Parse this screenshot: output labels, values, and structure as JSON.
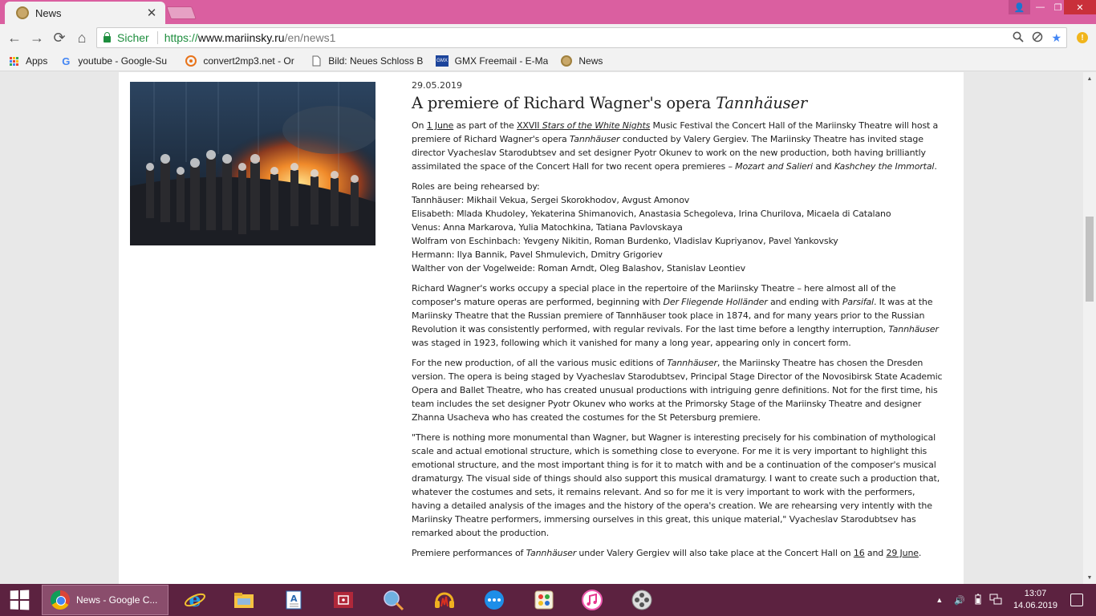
{
  "browser": {
    "tab": {
      "title": "News",
      "close": "✕"
    },
    "window_controls": {
      "user": "👤",
      "minimize": "—",
      "maximize": "❐",
      "close": "✕"
    },
    "toolbar": {
      "back": "←",
      "forward": "→",
      "reload": "⟳",
      "home": "⌂",
      "secure_label": "Sicher",
      "url_scheme": "https://",
      "url_host": "www.mariinsky.ru",
      "url_path": "/en/news1",
      "menu_glyph": "!"
    },
    "bookmarks": [
      {
        "label": "Apps",
        "icon": "apps-grid-icon"
      },
      {
        "label": "youtube - Google-Su",
        "icon": "google-icon"
      },
      {
        "label": "convert2mp3.net - Or",
        "icon": "convert2mp3-icon"
      },
      {
        "label": "Bild: Neues Schloss B",
        "icon": "page-icon"
      },
      {
        "label": "GMX Freemail - E-Ma",
        "icon": "gmx-icon"
      },
      {
        "label": "News",
        "icon": "mariinsky-icon"
      }
    ]
  },
  "article": {
    "date": "29.05.2019",
    "headline_prefix": "A premiere of Richard Wagner's opera ",
    "headline_em": "Tannhäuser",
    "p1": {
      "a": "On ",
      "date_link": "1 June",
      "b": " as part of the ",
      "fest_link_roman": "XXVII",
      "fest_link_space": " ",
      "fest_link_em": "Stars of the White Nights",
      "c": " Music Festival the Concert Hall of the Mariinsky Theatre will host a premiere of Richard Wagner's opera ",
      "d_em": "Tannhäuser",
      "e": " conducted by Valery Gergiev. The Mariinsky Theatre has invited stage director Vyacheslav Starodubtsev and set designer Pyotr Okunev to work on the new production, both having brilliantly assimilated the space of the Concert Hall for two recent opera premieres – ",
      "f_em": "Mozart and Salieri",
      "g": " and ",
      "h_em": "Kashchey the Immortal",
      "i": "."
    },
    "roles": [
      "Roles are being rehearsed by:",
      "Tannhäuser: Mikhail Vekua, Sergei Skorokhodov, Avgust Amonov",
      "Elisabeth: Mlada Khudoley, Yekaterina Shimanovich, Anastasia Schegoleva, Irina Churilova, Micaela di Catalano",
      "Venus: Anna Markarova, Yulia Matochkina, Tatiana Pavlovskaya",
      "Wolfram von Eschinbach: Yevgeny Nikitin, Roman Burdenko, Vladislav Kupriyanov, Pavel Yankovsky",
      "Hermann: Ilya Bannik, Pavel Shmulevich, Dmitry Grigoriev",
      "Walther von der Vogelweide: Roman Arndt, Oleg Balashov, Stanislav Leontiev"
    ],
    "p3": {
      "a": "Richard Wagner's works occupy a special place in the repertoire of the Mariinsky Theatre – here almost all of the composer's mature operas are performed, beginning with ",
      "b_em": "Der Fliegende Holländer",
      "c": " and ending with ",
      "d_em": "Parsifal",
      "e": ". It was at the Mariinsky Theatre that the Russian premiere of Tannhäuser took place in 1874, and for many years prior to the Russian Revolution it was consistently performed, with regular revivals. For the last time before a lengthy interruption, ",
      "f_em": "Tannhäuser",
      "g": " was staged in 1923, following which it vanished for many a long year, appearing only in concert form."
    },
    "p4": {
      "a": "For the new production, of all the various music editions of ",
      "b_em": "Tannhäuser",
      "c": ", the Mariinsky Theatre has chosen the Dresden version. The opera is being staged by Vyacheslav Starodubtsev, Principal Stage Director of the Novosibirsk State Academic Opera and Ballet Theatre, who has created unusual productions with intriguing genre definitions. Not for the first time, his team includes the set designer Pyotr Okunev who works at the Primorsky Stage of the Mariinsky Theatre and designer Zhanna Usacheva who has created the costumes for the St Petersburg premiere."
    },
    "p5": "\"There is nothing more monumental than Wagner, but Wagner is interesting precisely for his combination of mythological scale and actual emotional structure, which is something close to everyone. For me it is very important to highlight this emotional structure, and the most important thing is for it to match with and be a continuation of the composer's musical dramaturgy. The visual side of things should also support this musical dramaturgy. I want to create such a production that, whatever the costumes and sets, it remains relevant. And so for me it is very important to work with the performers, having a detailed analysis of the images and the history of the opera's creation. We are rehearsing very intently with the Mariinsky Theatre performers, immersing ourselves in this great, this unique material,\" Vyacheslav Starodubtsev has remarked about the production.",
    "p6": {
      "a": "Premiere performances of ",
      "b_em": "Tannhäuser",
      "c": " under Valery Gergiev will also take place at the Concert Hall on ",
      "link1": "16",
      "d": " and ",
      "link2": "29 June",
      "e": "."
    }
  },
  "taskbar": {
    "active_task": "News - Google C...",
    "pinned": [
      "internet-explorer-icon",
      "file-explorer-icon",
      "wordpad-icon",
      "media-app-icon",
      "magnifier-icon",
      "audio-app-icon",
      "chat-app-icon",
      "paint-app-icon",
      "itunes-icon",
      "video-reel-icon"
    ],
    "tray_up": "▲",
    "volume": "🔊",
    "time": "13:07",
    "date": "14.06.2019"
  },
  "colors": {
    "titlebar": "#da5fa0",
    "taskbar": "#5c2240",
    "secure_green": "#1e8e3e"
  }
}
